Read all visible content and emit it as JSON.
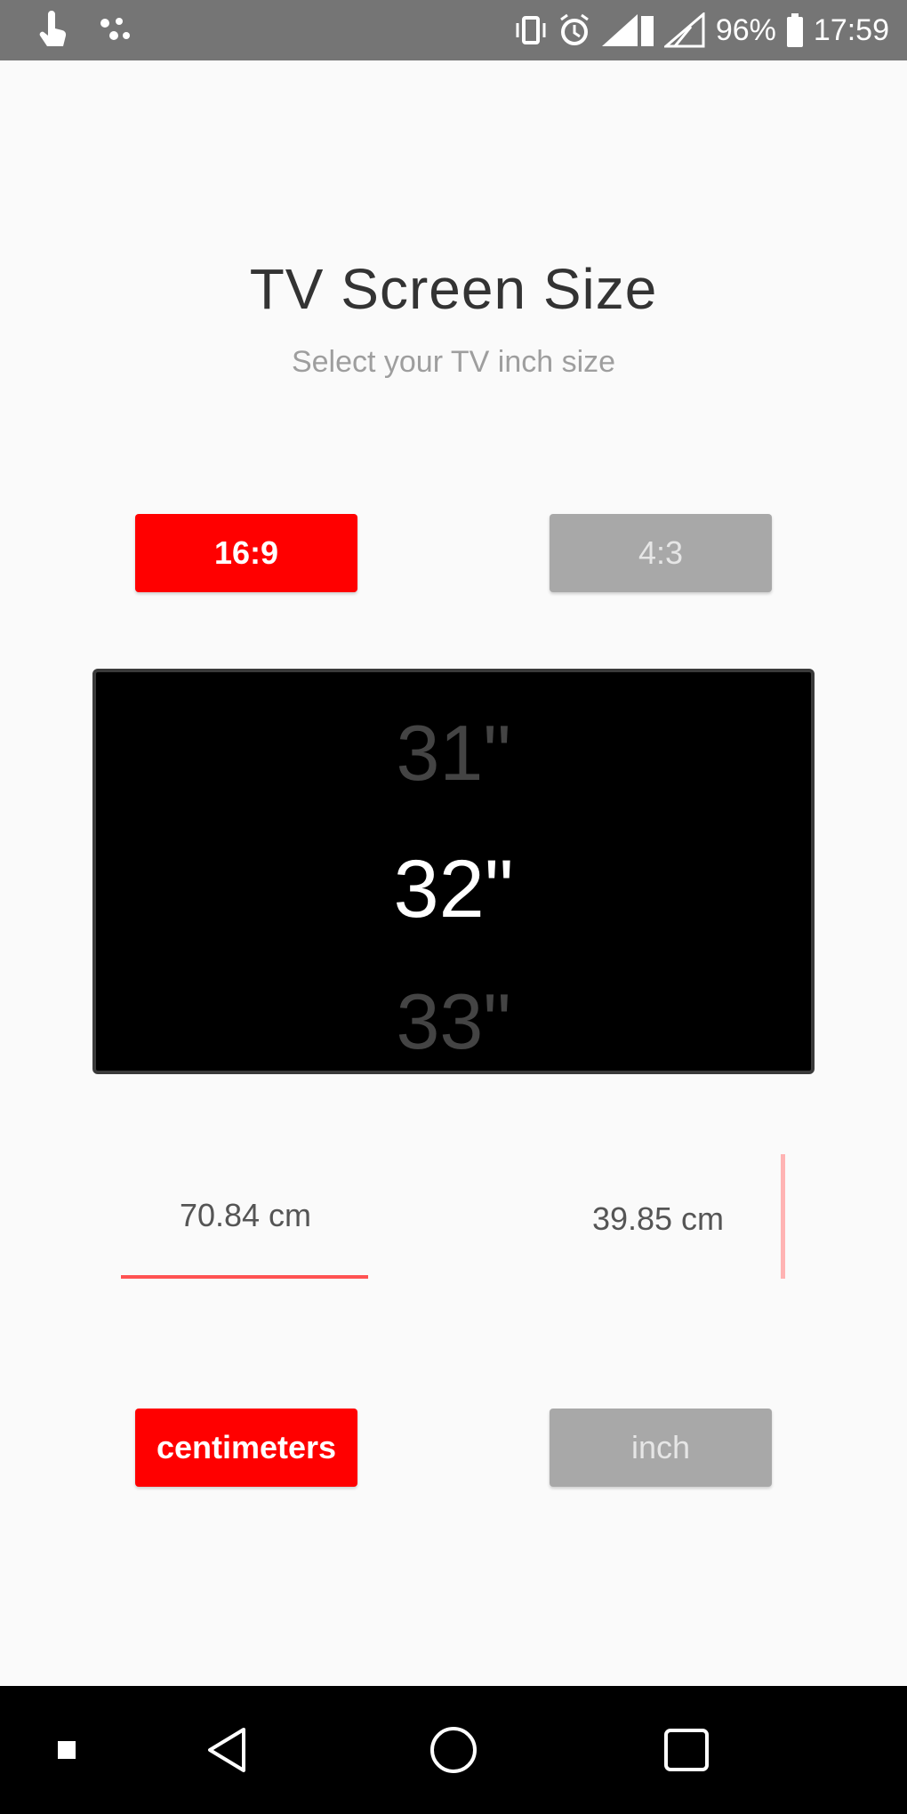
{
  "status_bar": {
    "battery_percent": "96%",
    "time": "17:59",
    "icons": [
      "touch-icon",
      "cast-icon",
      "vibrate-icon",
      "alarm-icon",
      "signal-icon",
      "signal-icon",
      "battery-icon"
    ]
  },
  "header": {
    "title": "TV Screen Size",
    "subtitle": "Select your TV inch size"
  },
  "aspect": {
    "option_16_9": "16:9",
    "option_4_3": "4:3",
    "selected": "16:9"
  },
  "picker": {
    "prev": "31\"",
    "selected": "32\"",
    "next": "33\""
  },
  "dimensions": {
    "width": "70.84 cm",
    "height": "39.85 cm"
  },
  "units": {
    "centimeters": "centimeters",
    "inch": "inch",
    "selected": "centimeters"
  },
  "colors": {
    "accent": "#ff0000",
    "inactive": "#a8a8a8",
    "status_bar": "#757575"
  },
  "nav_bar": {
    "icons": [
      "square-small-icon",
      "back-icon",
      "home-icon",
      "recents-icon"
    ]
  }
}
